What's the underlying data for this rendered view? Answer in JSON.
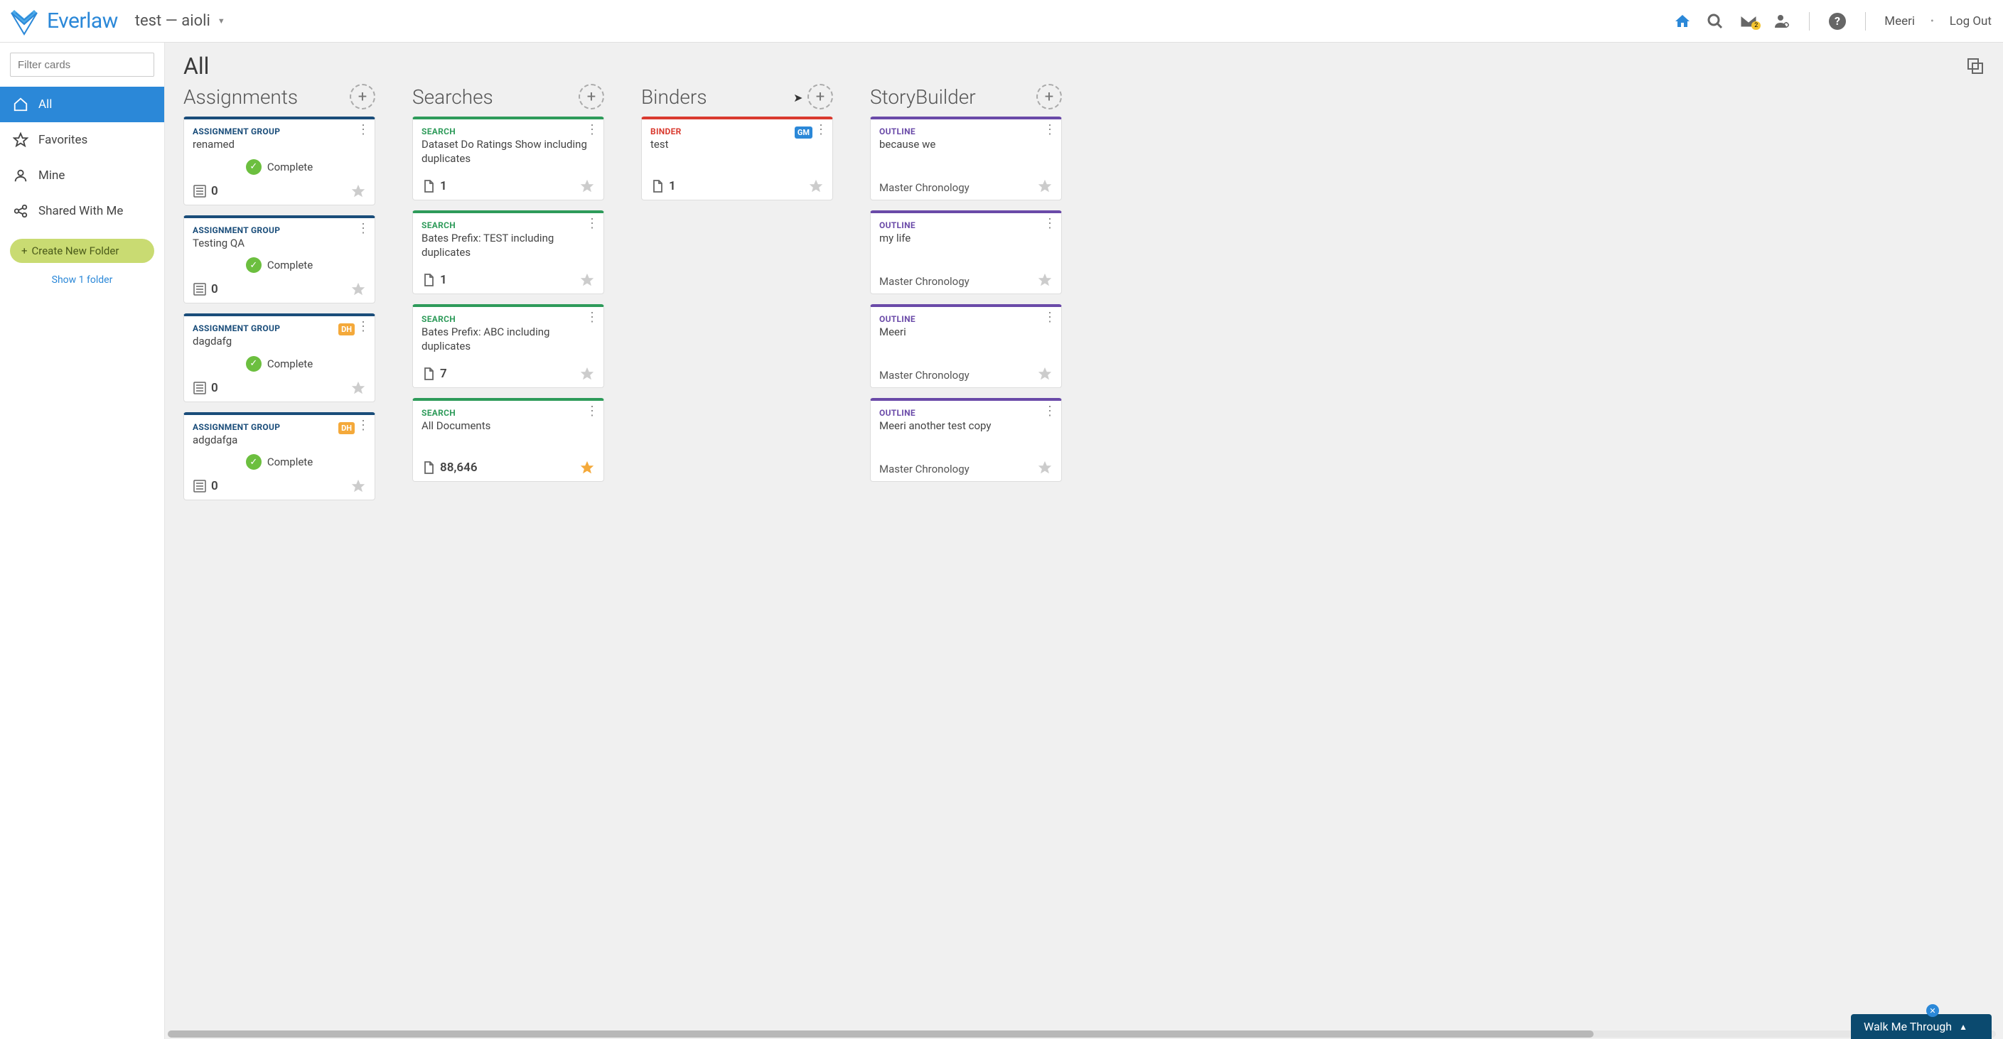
{
  "brand": "Everlaw",
  "project": "test — aioli",
  "header": {
    "mail_badge": "2",
    "user": "Meeri",
    "logout": "Log Out"
  },
  "sidebar": {
    "filter_placeholder": "Filter cards",
    "items": [
      {
        "label": "All"
      },
      {
        "label": "Favorites"
      },
      {
        "label": "Mine"
      },
      {
        "label": "Shared With Me"
      }
    ],
    "create_folder": "Create New Folder",
    "show_folders": "Show 1 folder"
  },
  "page": {
    "title": "All"
  },
  "columns": {
    "assignments": {
      "title": "Assignments",
      "cards": [
        {
          "type": "ASSIGNMENT GROUP",
          "name": "renamed",
          "status": "Complete",
          "count": "0"
        },
        {
          "type": "ASSIGNMENT GROUP",
          "name": "Testing QA",
          "status": "Complete",
          "count": "0"
        },
        {
          "type": "ASSIGNMENT GROUP",
          "name": "dagdafg",
          "status": "Complete",
          "count": "0",
          "chip": "DH"
        },
        {
          "type": "ASSIGNMENT GROUP",
          "name": "adgdafga",
          "status": "Complete",
          "count": "0",
          "chip": "DH"
        }
      ]
    },
    "searches": {
      "title": "Searches",
      "cards": [
        {
          "type": "SEARCH",
          "name": "Dataset Do Ratings Show including duplicates",
          "count": "1"
        },
        {
          "type": "SEARCH",
          "name": "Bates Prefix: TEST including duplicates",
          "count": "1"
        },
        {
          "type": "SEARCH",
          "name": "Bates Prefix: ABC including duplicates",
          "count": "7"
        },
        {
          "type": "SEARCH",
          "name": "All Documents",
          "count": "88,646",
          "fav": true
        }
      ]
    },
    "binders": {
      "title": "Binders",
      "cards": [
        {
          "type": "BINDER",
          "name": "test",
          "count": "1",
          "chip": "GM",
          "chip_color": "blue"
        }
      ]
    },
    "storybuilder": {
      "title": "StoryBuilder",
      "cards": [
        {
          "type": "OUTLINE",
          "name": "because we",
          "sub": "Master Chronology"
        },
        {
          "type": "OUTLINE",
          "name": "my life",
          "sub": "Master Chronology"
        },
        {
          "type": "OUTLINE",
          "name": "Meeri",
          "sub": "Master Chronology"
        },
        {
          "type": "OUTLINE",
          "name": "Meeri another test copy",
          "sub": "Master Chronology"
        }
      ]
    }
  },
  "walkme": "Walk Me Through"
}
